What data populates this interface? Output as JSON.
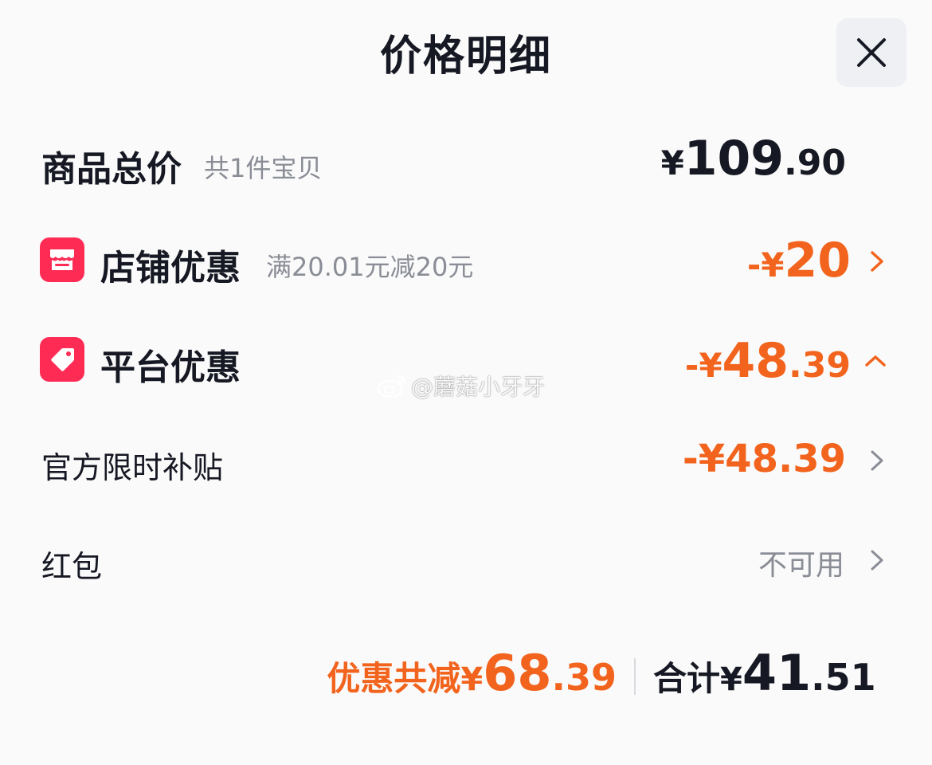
{
  "header": {
    "title": "价格明细"
  },
  "product_total": {
    "label": "商品总价",
    "sub": "共1件宝贝",
    "yen": "¥",
    "int": "109",
    "dec": ".90"
  },
  "store_discount": {
    "icon": "store-icon",
    "label": "店铺优惠",
    "sub": "满20.01元减20元",
    "prefix": "-¥",
    "int": "20",
    "dec": ""
  },
  "platform_discount": {
    "icon": "tag-icon",
    "label": "平台优惠",
    "prefix": "-¥",
    "int": "48",
    "dec": ".39",
    "expanded": true
  },
  "subsidy": {
    "label": "官方限时补贴",
    "value": "-¥48.39"
  },
  "red_packet": {
    "label": "红包",
    "value": "不可用"
  },
  "watermark": {
    "text": "@蘑菇小牙牙"
  },
  "footer": {
    "discount_label": "优惠共减",
    "discount_yen": "¥",
    "discount_int": "68",
    "discount_dec": ".39",
    "total_label": "合计",
    "total_yen": "¥",
    "total_int": "41",
    "total_dec": ".51"
  },
  "colors": {
    "accent_orange": "#f2641d",
    "brand_red": "#fe2c55",
    "text_dark": "#161823",
    "text_gray": "#8a8d96"
  }
}
